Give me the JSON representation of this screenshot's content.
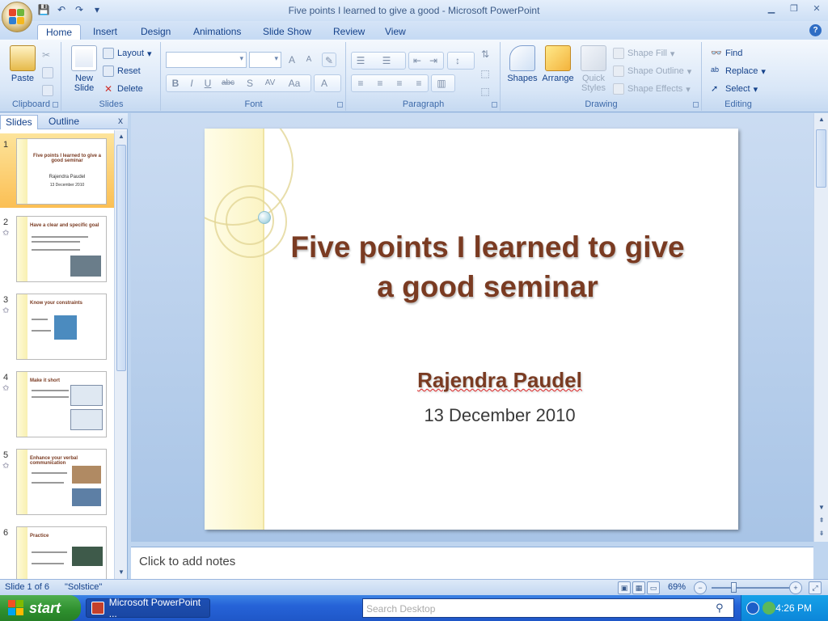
{
  "window": {
    "title": "Five points I learned to give a good - Microsoft PowerPoint",
    "help": "?"
  },
  "ribbon": {
    "tabs": [
      {
        "label": "Home"
      },
      {
        "label": "Insert"
      },
      {
        "label": "Design"
      },
      {
        "label": "Animations"
      },
      {
        "label": "Slide Show"
      },
      {
        "label": "Review"
      },
      {
        "label": "View"
      }
    ],
    "clipboard": {
      "label": "Clipboard",
      "paste": "Paste"
    },
    "slides": {
      "label": "Slides",
      "new_slide_line1": "New",
      "new_slide_line2": "Slide",
      "layout": "Layout",
      "reset": "Reset",
      "delete": "Delete"
    },
    "font": {
      "label": "Font",
      "grow": "A",
      "shrink": "A",
      "bold": "B",
      "italic": "I",
      "underline": "U",
      "strike": "abc",
      "shadow": "S",
      "spacing": "AV",
      "case": "Aa",
      "color": "A"
    },
    "paragraph": {
      "label": "Paragraph"
    },
    "drawing": {
      "label": "Drawing",
      "shapes": "Shapes",
      "arrange": "Arrange",
      "quick_styles_line1": "Quick",
      "quick_styles_line2": "Styles",
      "shape_fill": "Shape Fill",
      "shape_outline": "Shape Outline",
      "shape_effects": "Shape Effects"
    },
    "editing": {
      "label": "Editing",
      "find": "Find",
      "replace": "Replace",
      "select": "Select"
    }
  },
  "panel": {
    "tabs": [
      {
        "label": "Slides"
      },
      {
        "label": "Outline"
      }
    ],
    "close": "x",
    "thumbnails": [
      {
        "num": "1",
        "title": "Five points I learned to give a good seminar",
        "sub": "Rajendra Paudel",
        "date": "13 December 2010"
      },
      {
        "num": "2",
        "title": "Have a clear and specific goal"
      },
      {
        "num": "3",
        "title": "Know your constraints"
      },
      {
        "num": "4",
        "title": "Make it short"
      },
      {
        "num": "5",
        "title": "Enhance your verbal communication"
      },
      {
        "num": "6",
        "title": "Practice"
      }
    ]
  },
  "slide": {
    "title": "Five points I learned to give a good seminar",
    "author": "Rajendra Paudel",
    "date": "13 December 2010"
  },
  "notes": {
    "placeholder": "Click to add notes"
  },
  "status": {
    "slide_info": "Slide 1 of 6",
    "theme": "\"Solstice\"",
    "zoom": "69%",
    "zoom_minus": "−",
    "zoom_plus": "+"
  },
  "taskbar": {
    "start": "start",
    "task": "Microsoft PowerPoint ...",
    "search_placeholder": "Search Desktop",
    "clock": "4:26 PM"
  }
}
